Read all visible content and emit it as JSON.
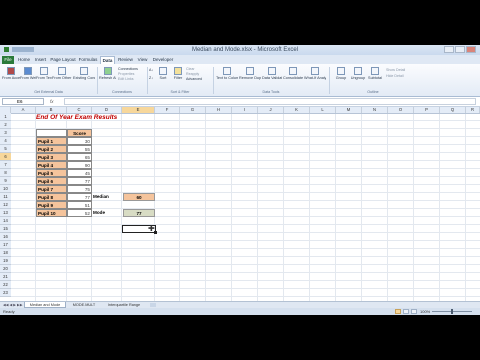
{
  "window": {
    "title": "Median and Mode.xlsx - Microsoft Excel"
  },
  "ribbon": {
    "tabs": [
      "File",
      "Home",
      "Insert",
      "Page Layout",
      "Formulas",
      "Data",
      "Review",
      "View",
      "Developer"
    ],
    "active_tab": "Data",
    "buttons": [
      {
        "label": "From Access"
      },
      {
        "label": "From Web"
      },
      {
        "label": "From Text"
      },
      {
        "label": "From Other Sources"
      },
      {
        "label": "Existing Connections"
      },
      {
        "label": "Refresh All"
      },
      {
        "label": "Sort"
      },
      {
        "label": "Filter"
      },
      {
        "label": "Text to Columns"
      },
      {
        "label": "Remove Duplicates"
      },
      {
        "label": "Data Validation"
      },
      {
        "label": "Consolidate"
      },
      {
        "label": "What-If Analysis"
      },
      {
        "label": "Group"
      },
      {
        "label": "Ungroup"
      },
      {
        "label": "Subtotal"
      }
    ],
    "small_buttons": {
      "connections": [
        "Connections",
        "Properties",
        "Edit Links"
      ],
      "sort_filter": [
        "Clear",
        "Reapply",
        "Advanced"
      ],
      "outline": [
        "Show Detail",
        "Hide Detail"
      ]
    },
    "groups": [
      "Get External Data",
      "Connections",
      "Sort & Filter",
      "Data Tools",
      "Outline"
    ]
  },
  "formula_bar": {
    "name_box": "E6",
    "fx": "fx",
    "formula": ""
  },
  "columns": [
    "A",
    "B",
    "C",
    "D",
    "E",
    "F",
    "G",
    "H",
    "I",
    "J",
    "K",
    "L",
    "M",
    "N",
    "O",
    "P",
    "Q",
    "R"
  ],
  "rows": [
    "1",
    "2",
    "3",
    "4",
    "5",
    "6",
    "7",
    "8",
    "9",
    "10",
    "11",
    "12",
    "13",
    "14",
    "15",
    "16",
    "17",
    "18",
    "19",
    "20",
    "21",
    "22",
    "23"
  ],
  "sheet": {
    "title": "End Of Year Exam Results",
    "score_header": "Score",
    "pupils": [
      {
        "name": "Pupil 1",
        "score": "30"
      },
      {
        "name": "Pupil 2",
        "score": "55"
      },
      {
        "name": "Pupil 3",
        "score": "65"
      },
      {
        "name": "Pupil 4",
        "score": "90"
      },
      {
        "name": "Pupil 5",
        "score": "45"
      },
      {
        "name": "Pupil 6",
        "score": "77"
      },
      {
        "name": "Pupil 7",
        "score": "75"
      },
      {
        "name": "Pupil 8",
        "score": "77"
      },
      {
        "name": "Pupil 9",
        "score": "51"
      },
      {
        "name": "Pupil 10",
        "score": "52"
      }
    ],
    "median_label": "Median",
    "median_value": "60",
    "mode_label": "Mode",
    "mode_value": "77"
  },
  "sheet_tabs": [
    "Median and Mode",
    "MODE.MULT",
    "Interquartile Range"
  ],
  "status": {
    "ready": "Ready",
    "zoom": "100%"
  },
  "colors": {
    "header_fill": "#f5c49c",
    "mode_fill": "#d8dcc4",
    "title_red": "#c00000",
    "accent": "#f7d79b"
  }
}
